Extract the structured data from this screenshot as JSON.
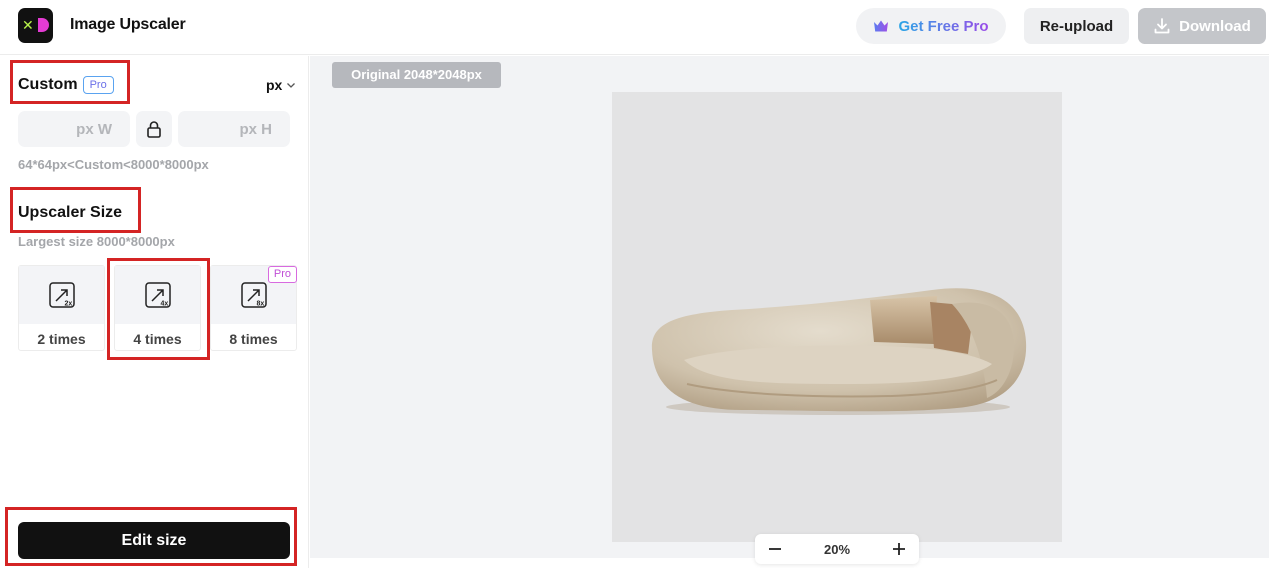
{
  "header": {
    "app_title": "Image Upscaler",
    "get_pro_label": "Get Free Pro",
    "reupload_label": "Re-upload",
    "download_label": "Download"
  },
  "sidebar": {
    "custom": {
      "title": "Custom",
      "pro_badge": "Pro",
      "unit": "px",
      "width_placeholder": "px W",
      "height_placeholder": "px H",
      "range_hint": "64*64px<Custom<8000*8000px"
    },
    "upscaler": {
      "title": "Upscaler Size",
      "largest_hint": "Largest size 8000*8000px",
      "options": [
        {
          "label": "2 times",
          "icon_text": "2x"
        },
        {
          "label": "4 times",
          "icon_text": "4x"
        },
        {
          "label": "8 times",
          "icon_text": "8x",
          "pro_tag": "Pro"
        }
      ],
      "selected": "4 times"
    },
    "edit_button": "Edit size"
  },
  "canvas": {
    "original_tag": "Original 2048*2048px",
    "zoom_level": "20%"
  },
  "colors": {
    "annotation_red": "#d42424",
    "pro_gradient_start": "#2aa6e6",
    "pro_gradient_end": "#9b4be8",
    "primary_button": "#111111"
  },
  "icons": [
    "logo-icon",
    "crown-icon",
    "download-icon",
    "chevron-down-icon",
    "lock-icon",
    "upscale-2x-icon",
    "upscale-4x-icon",
    "upscale-8x-icon",
    "zoom-out-icon",
    "zoom-in-icon"
  ]
}
